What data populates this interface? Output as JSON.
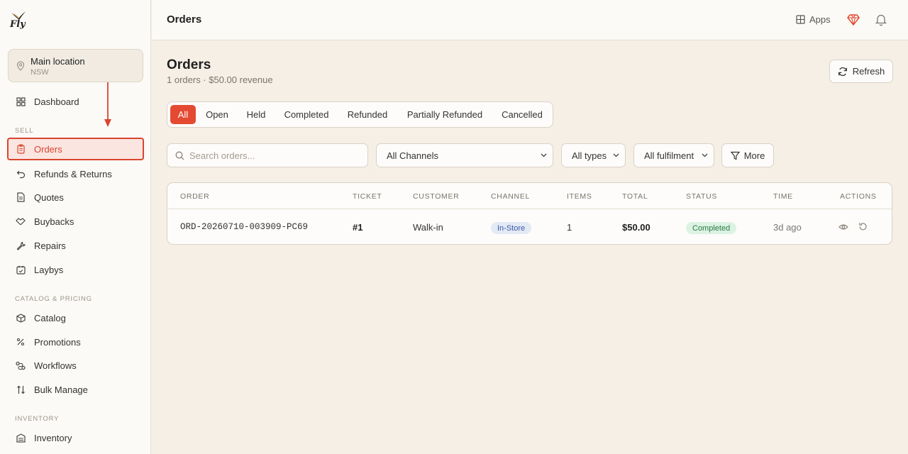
{
  "brand": {
    "logo_text": "Fly"
  },
  "location": {
    "name": "Main location",
    "region": "NSW"
  },
  "sidebar": {
    "dashboard": "Dashboard",
    "sections": {
      "sell": "SELL",
      "catalog": "CATALOG & PRICING",
      "inventory": "INVENTORY"
    },
    "items": {
      "orders": "Orders",
      "refunds": "Refunds & Returns",
      "quotes": "Quotes",
      "buybacks": "Buybacks",
      "repairs": "Repairs",
      "laybys": "Laybys",
      "catalog": "Catalog",
      "promotions": "Promotions",
      "workflows": "Workflows",
      "bulk_manage": "Bulk Manage",
      "inventory": "Inventory"
    }
  },
  "topbar": {
    "title": "Orders",
    "apps_label": "Apps"
  },
  "page": {
    "title": "Orders",
    "subtitle": "1 orders · $50.00 revenue",
    "refresh_label": "Refresh"
  },
  "tabs": [
    "All",
    "Open",
    "Held",
    "Completed",
    "Refunded",
    "Partially Refunded",
    "Cancelled"
  ],
  "filters": {
    "search_placeholder": "Search orders...",
    "channel": "All Channels",
    "types": "All types",
    "fulfilment": "All fulfilment",
    "more_label": "More"
  },
  "table": {
    "headers": [
      "ORDER",
      "TICKET",
      "CUSTOMER",
      "CHANNEL",
      "ITEMS",
      "TOTAL",
      "STATUS",
      "TIME",
      "ACTIONS"
    ],
    "rows": [
      {
        "order": "ORD-20260710-003909-PC69",
        "ticket": "#1",
        "customer": "Walk-in",
        "channel": "In-Store",
        "items": "1",
        "total": "$50.00",
        "status": "Completed",
        "time": "3d ago"
      }
    ]
  },
  "colors": {
    "accent": "#e44a32",
    "annotation": "#d9452f",
    "background": "#f5efe6"
  }
}
